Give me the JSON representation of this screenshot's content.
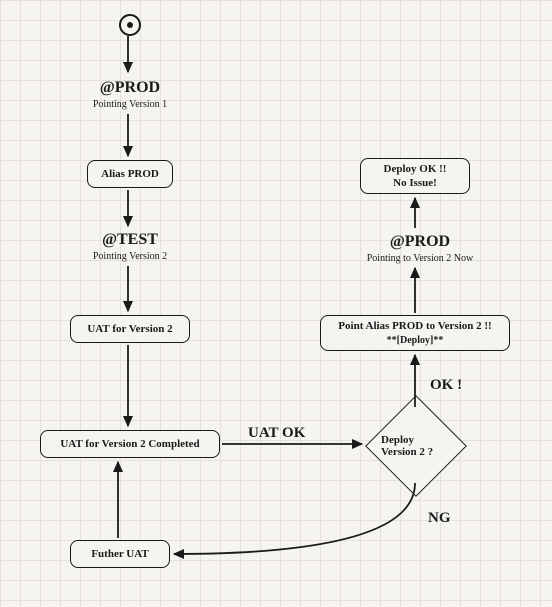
{
  "chart_data": {
    "type": "flowchart",
    "nodes": [
      {
        "id": "start",
        "kind": "start",
        "label": ""
      },
      {
        "id": "prod1",
        "kind": "annotation",
        "title": "@PROD",
        "subtitle": "Pointing Version 1"
      },
      {
        "id": "alias",
        "kind": "process",
        "label": "Alias PROD"
      },
      {
        "id": "test",
        "kind": "annotation",
        "title": "@TEST",
        "subtitle": "Pointing Version 2"
      },
      {
        "id": "uat",
        "kind": "process",
        "label": "UAT for Version 2"
      },
      {
        "id": "uatdone",
        "kind": "process",
        "label": "UAT for Version 2 Completed"
      },
      {
        "id": "further",
        "kind": "process",
        "label": "Futher UAT"
      },
      {
        "id": "dec",
        "kind": "decision",
        "label": "Deploy Version 2 ?"
      },
      {
        "id": "point",
        "kind": "process",
        "label": "Point Alias PROD to Version 2 !!",
        "label2": "**[Deploy]**"
      },
      {
        "id": "prod2",
        "kind": "annotation",
        "title": "@PROD",
        "subtitle": "Pointing to Version 2 Now"
      },
      {
        "id": "deployok",
        "kind": "process",
        "label": "Deploy OK !!",
        "label2": "No Issue!"
      }
    ],
    "edges": [
      {
        "from": "start",
        "to": "alias",
        "via": "prod1",
        "label": ""
      },
      {
        "from": "alias",
        "to": "uat",
        "via": "test",
        "label": ""
      },
      {
        "from": "uat",
        "to": "uatdone",
        "label": ""
      },
      {
        "from": "uatdone",
        "to": "dec",
        "label": "UAT OK"
      },
      {
        "from": "dec",
        "to": "point",
        "label": "OK !"
      },
      {
        "from": "dec",
        "to": "further",
        "label": "NG"
      },
      {
        "from": "further",
        "to": "uatdone",
        "label": ""
      },
      {
        "from": "point",
        "to": "deployok",
        "via": "prod2",
        "label": ""
      }
    ],
    "edge_labels": {
      "uatok": "UAT OK",
      "ok": "OK !",
      "ng": "NG"
    }
  }
}
